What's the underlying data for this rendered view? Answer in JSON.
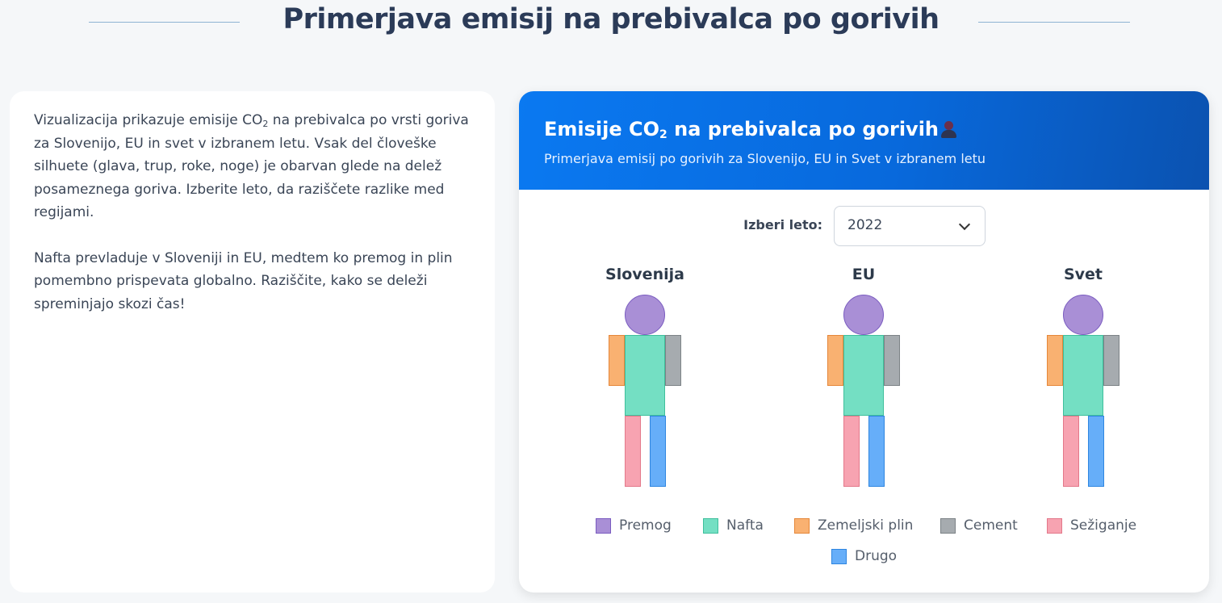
{
  "page": {
    "title": "Primerjava emisij na prebivalca po gorivih"
  },
  "intro": {
    "paragraph1_pre": "Vizualizacija prikazuje emisije CO",
    "paragraph1_sub": "2",
    "paragraph1_post": " na prebivalca po vrsti goriva za Slovenijo, EU in svet v izbranem letu. Vsak del človeške silhuete (glava, trup, roke, noge) je obarvan glede na delež posameznega goriva. Izberite leto, da raziščete razlike med regijami.",
    "paragraph2": "Nafta prevladuje v Sloveniji in EU, medtem ko premog in plin pomembno prispevata globalno. Raziščite, kako se deleži spreminjajo skozi čas!"
  },
  "card": {
    "title_pre": "Emisije CO",
    "title_sub": "2",
    "title_post": " na prebivalca po gorivih",
    "title_icon": "person-silhouette-icon",
    "subtitle": "Primerjava emisij po gorivih za Slovenijo, EU in Svet v izbranem letu"
  },
  "year_selector": {
    "label": "Izberi leto:",
    "selected": "2022"
  },
  "regions": [
    {
      "name": "Slovenija"
    },
    {
      "name": "EU"
    },
    {
      "name": "Svet"
    }
  ],
  "body_parts": {
    "head": "Premog",
    "torso": "Nafta",
    "left_arm": "Zemeljski plin",
    "right_arm": "Cement",
    "left_leg": "Sežiganje",
    "right_leg": "Drugo"
  },
  "legend": [
    {
      "label": "Premog",
      "color": "#a98fd6",
      "border": "#7a5cc0"
    },
    {
      "label": "Nafta",
      "color": "#74dfc3",
      "border": "#3fbf9c"
    },
    {
      "label": "Zemeljski plin",
      "color": "#f9b171",
      "border": "#e5873a"
    },
    {
      "label": "Cement",
      "color": "#a6abaf",
      "border": "#7c8286"
    },
    {
      "label": "Sežiganje",
      "color": "#f7a3b1",
      "border": "#e3788a"
    },
    {
      "label": "Drugo",
      "color": "#66aef9",
      "border": "#2f86e0"
    }
  ]
}
